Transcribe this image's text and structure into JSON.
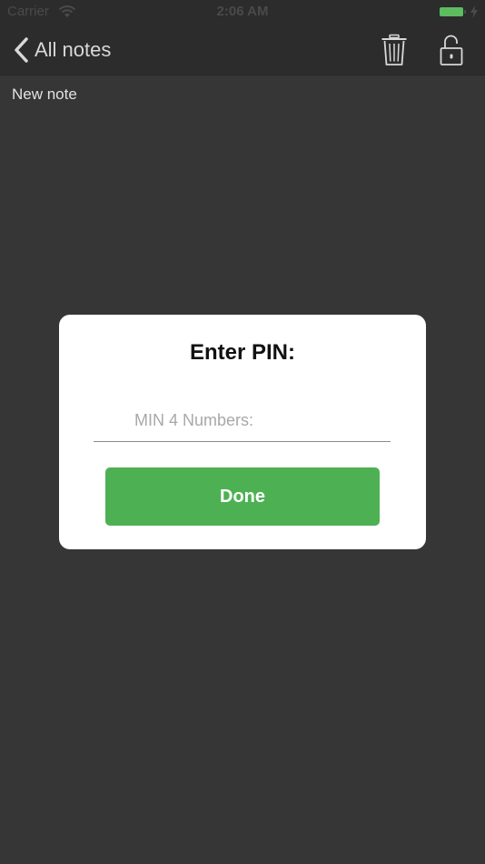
{
  "status_bar": {
    "carrier": "Carrier",
    "time": "2:06 AM",
    "battery_color": "#5bbd5f"
  },
  "nav": {
    "back_label": "All notes",
    "back_icon": "chevron-left-icon",
    "trash_icon": "trash-icon",
    "lock_icon": "unlock-icon"
  },
  "note": {
    "title": "New note"
  },
  "pin_dialog": {
    "title": "Enter PIN:",
    "input_placeholder": "MIN 4 Numbers:",
    "input_value": "",
    "done_label": "Done",
    "done_color": "#4db153"
  },
  "colors": {
    "background": "#363636",
    "bar": "#2c2c2c",
    "accent_green": "#4db153"
  }
}
